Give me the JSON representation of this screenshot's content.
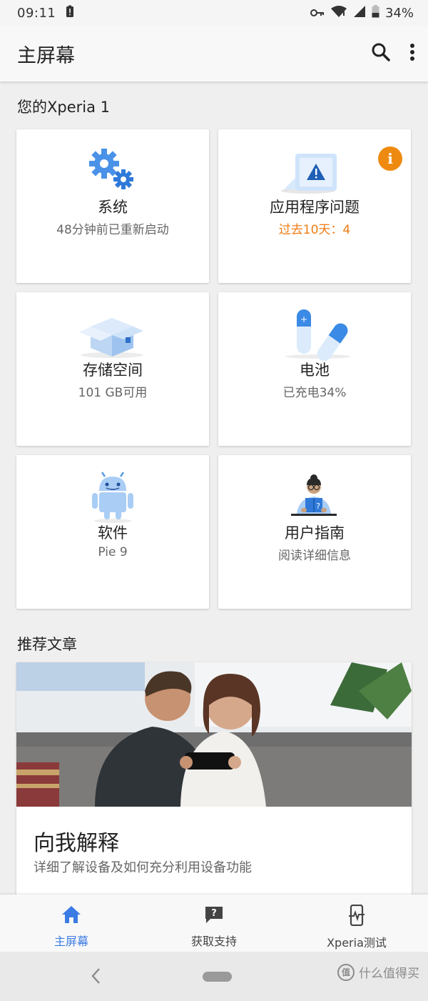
{
  "status_bar": {
    "time": "09:11",
    "battery": "34%"
  },
  "app_bar": {
    "title": "主屏幕"
  },
  "device_section": {
    "title": "您的Xperia 1",
    "cards": [
      {
        "title": "系统",
        "subtitle": "48分钟前已重新启动",
        "icon": "gears-icon"
      },
      {
        "title": "应用程序问题",
        "subtitle": "过去10天：4",
        "icon": "warning-window-icon",
        "badge": "i"
      },
      {
        "title": "存储空间",
        "subtitle": "101 GB可用",
        "icon": "storage-box-icon"
      },
      {
        "title": "电池",
        "subtitle": "已充电34%",
        "icon": "battery-icon"
      },
      {
        "title": "软件",
        "subtitle": "Pie 9",
        "icon": "android-icon"
      },
      {
        "title": "用户指南",
        "subtitle": "阅读详细信息",
        "icon": "reader-icon"
      }
    ]
  },
  "recommended_section": {
    "title": "推荐文章",
    "article": {
      "title": "向我解释",
      "subtitle": "详细了解设备及如何充分利用设备功能"
    }
  },
  "bottom_nav": [
    {
      "label": "主屏幕",
      "icon": "home-icon",
      "active": true
    },
    {
      "label": "获取支持",
      "icon": "support-chat-icon",
      "active": false
    },
    {
      "label": "Xperia测试",
      "icon": "phone-test-icon",
      "active": false
    }
  ],
  "watermark": {
    "text": "什么值得买",
    "badge": "值"
  },
  "colors": {
    "accent": "#3b7be4",
    "warning": "#f07c14",
    "badge": "#ef8a10"
  }
}
